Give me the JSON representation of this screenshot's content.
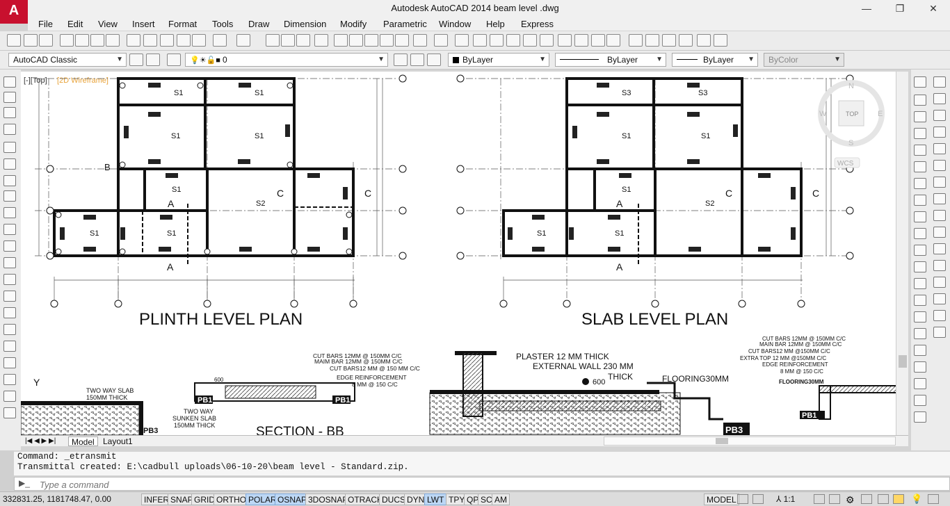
{
  "app": {
    "logo_glyph": "A",
    "title": "Autodesk AutoCAD 2014    beam level .dwg"
  },
  "window_controls": {
    "minimize": "—",
    "restore": "❐",
    "close": "✕"
  },
  "menu": [
    "File",
    "Edit",
    "View",
    "Insert",
    "Format",
    "Tools",
    "Draw",
    "Dimension",
    "Modify",
    "Parametric",
    "Window",
    "Help",
    "Express"
  ],
  "toolbar2": {
    "workspace": "AutoCAD Classic",
    "layer": "0",
    "color": "ByLayer",
    "linetype": "ByLayer",
    "lineweight": "ByLayer",
    "plotstyle": "ByColor"
  },
  "viewport": {
    "label_view": "[-][Top]",
    "label_style": "[2D Wireframe]"
  },
  "viewcube": {
    "n": "N",
    "s": "S",
    "e": "E",
    "w": "W",
    "top": "TOP",
    "ucs": "WCS"
  },
  "plans": {
    "plinth_title": "PLINTH LEVEL PLAN",
    "slab_title": "SLAB LEVEL PLAN"
  },
  "sections": {
    "title": "SECTION - BB",
    "plaster": "PLASTER 12 MM THICK",
    "ext_wall": "EXTERNAL WALL 230 MM",
    "thick": "THICK",
    "flooring": "FLOORING30MM",
    "dim600": "600",
    "two_way_slab": "TWO WAY SLAB",
    "thick150": "150MM THICK",
    "two_way": "TWO WAY",
    "sunken": "SUNKEN SLAB",
    "sunken_thick": "150MM THICK",
    "cut_bars": "CUT BARS 12MM @ 150MM C/C",
    "main_bar": "MAIM BAR 12MM @ 150MM C/C",
    "cut_bars2": "CUT BARS12 MM @ 150 MM C/C",
    "edge_reinf": "EDGE REINFORCEMENT",
    "edge_8mm": "8 MM @ 150 C/C",
    "r_cut": "CUT BARS 12MM @ 150MM C/C",
    "r_main": "MAIN BAR 12MM @ 150MM C/C",
    "r_cut2": "CUT BARS12 MM @150MM C/C",
    "r_extra": "EXTRA TOP 12 MM @150MM C/C",
    "r_edge": "EDGE REINFORCEMENT",
    "r_8mm": "8 MM @ 150 C/C",
    "r_floor": "FLOORING30MM",
    "pb1": "PB1",
    "pb3": "PB3",
    "y_axis": "Y"
  },
  "tabs": {
    "model": "Model",
    "layout1": "Layout1"
  },
  "command": {
    "line1": "Command: _etransmit",
    "line2": "Transmittal created: E:\\cadbull uploads\\06-10-20\\beam level - Standard.zip.",
    "placeholder": "Type a command"
  },
  "status": {
    "coords": "332831.25, 1181748.47, 0.00",
    "buttons": [
      "INFER",
      "SNAP",
      "GRID",
      "ORTHO",
      "POLAR",
      "OSNAP",
      "3DOSNAP",
      "OTRACK",
      "DUCS",
      "DYN",
      "LWT",
      "TPY",
      "QP",
      "SC",
      "AM"
    ],
    "on": [
      "POLAR",
      "OSNAP",
      "LWT"
    ],
    "model": "MODEL",
    "scale": "1:1"
  }
}
